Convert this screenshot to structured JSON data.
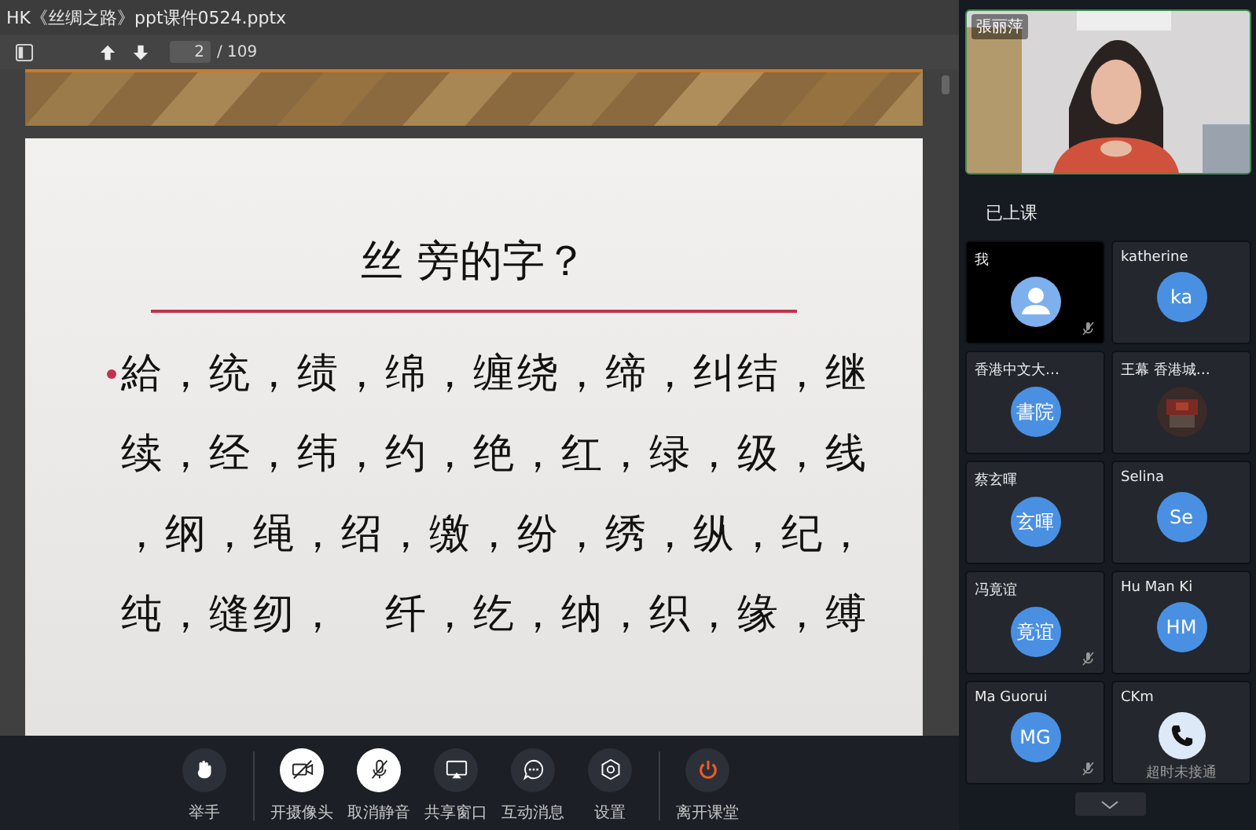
{
  "window": {
    "title": "HK《丝绸之路》ppt课件0524.pptx"
  },
  "toolbar": {
    "page": "2",
    "total": "/ 109"
  },
  "slide": {
    "title": "丝 旁的字？",
    "lines": [
      "給，统，绩，绵，缠绕，缔，纠结，继",
      "续，经，纬，约，绝，红，绿，级，线",
      "，纲，绳，绍，缴，纷，绣，纵，纪，",
      "纯，缝纫，　纤，纥，纳，织，缘，缚"
    ]
  },
  "video": {
    "name": "張丽萍"
  },
  "section_label": "已上课",
  "participants": [
    {
      "name": "我",
      "kind": "avatar",
      "muted": true
    },
    {
      "name": "katherine",
      "kind": "initials",
      "initials": "ka",
      "muted": false
    },
    {
      "name": "香港中文大…",
      "kind": "initials",
      "initials": "書院",
      "muted": false
    },
    {
      "name": "王幕 香港城…",
      "kind": "picture",
      "muted": false
    },
    {
      "name": "蔡玄暉",
      "kind": "initials",
      "initials": "玄暉",
      "muted": false
    },
    {
      "name": "Selina",
      "kind": "initials",
      "initials": "Se",
      "muted": false
    },
    {
      "name": "冯竟谊",
      "kind": "initials",
      "initials": "竟谊",
      "muted": true
    },
    {
      "name": "Hu Man Ki",
      "kind": "initials",
      "initials": "HM",
      "muted": false
    },
    {
      "name": "Ma Guorui",
      "kind": "initials",
      "initials": "MG",
      "muted": true
    },
    {
      "name": "CKm",
      "kind": "call",
      "status": "超时未接通",
      "muted": false
    }
  ],
  "controls": [
    {
      "label": "举手",
      "kind": "hand",
      "active": false,
      "divider_before": false
    },
    {
      "label": "开摄像头",
      "kind": "camera",
      "active": true,
      "divider_before": true
    },
    {
      "label": "取消静音",
      "kind": "mic",
      "active": true,
      "divider_before": false
    },
    {
      "label": "共享窗口",
      "kind": "share",
      "active": false,
      "divider_before": false
    },
    {
      "label": "互动消息",
      "kind": "chat",
      "active": false,
      "divider_before": false
    },
    {
      "label": "设置",
      "kind": "settings",
      "active": false,
      "divider_before": false
    },
    {
      "label": "离开课堂",
      "kind": "power",
      "active": false,
      "divider_before": true
    }
  ]
}
